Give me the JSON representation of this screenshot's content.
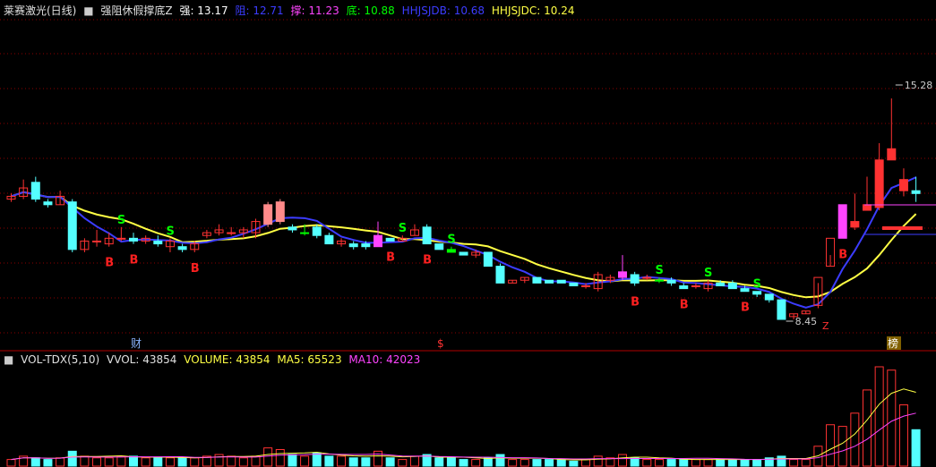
{
  "header": {
    "title": "莱赛激光(日线)",
    "indicator": "强阻休假撑底Z",
    "strong_label": "强: 13.17",
    "resist_label": "阻: 12.71",
    "support_label": "撑: 11.23",
    "bottom_label": "底: 10.88",
    "hhjsjdb_label": "HHJSJDB: 10.68",
    "hhjsjdc_label": "HHJSJDC: 10.24"
  },
  "volume_header": {
    "name": "VOL-TDX(5,10)",
    "vvol": "VVOL: 43854",
    "volume": "VOLUME: 43854",
    "ma5": "MA5: 65523",
    "ma10": "MA10: 42023"
  },
  "annotations": {
    "high": "15.28",
    "low": "8.45",
    "marker_cai": "财",
    "marker_s": "$",
    "marker_bang": "榜",
    "marker_z": "Z"
  },
  "colors": {
    "up": "#ff3232",
    "up_fill_light": "#ff9a9a",
    "down": "#54ffff",
    "down_dark": "#14b4b4",
    "buy_sig": "#ff2020",
    "sell_sig": "#00ff00",
    "magenta": "#ff44ff",
    "ma_blue": "#3c3cff",
    "ma_yellow": "#ffff44",
    "grid": "#8b0000",
    "white": "#ffffff"
  },
  "chart_data": [
    {
      "type": "candlestick",
      "title": "莱赛激光(日线)",
      "ohlc": [
        [
          11.2,
          11.4,
          11.1,
          11.3
        ],
        [
          11.3,
          11.9,
          11.2,
          11.6
        ],
        [
          11.8,
          12.0,
          11.1,
          11.2
        ],
        [
          11.1,
          11.2,
          10.9,
          11.0
        ],
        [
          11.0,
          11.5,
          11.0,
          11.3
        ],
        [
          11.1,
          11.2,
          9.3,
          9.4
        ],
        [
          9.4,
          9.8,
          9.3,
          9.7
        ],
        [
          9.7,
          10.1,
          9.5,
          9.7
        ],
        [
          9.6,
          10.0,
          9.5,
          9.8
        ],
        [
          9.8,
          10.2,
          9.7,
          9.8
        ],
        [
          9.8,
          10.0,
          9.6,
          9.7
        ],
        [
          9.7,
          9.9,
          9.6,
          9.8
        ],
        [
          9.7,
          9.9,
          9.5,
          9.6
        ],
        [
          9.5,
          9.8,
          9.3,
          9.7
        ],
        [
          9.5,
          9.6,
          9.3,
          9.4
        ],
        [
          9.4,
          9.7,
          9.3,
          9.6
        ],
        [
          9.9,
          10.1,
          9.8,
          10.0
        ],
        [
          10.0,
          10.3,
          9.9,
          10.1
        ],
        [
          10.0,
          10.2,
          9.9,
          10.0
        ],
        [
          10.0,
          10.2,
          9.8,
          10.1
        ],
        [
          10.0,
          10.5,
          9.8,
          10.4
        ],
        [
          10.3,
          11.1,
          10.2,
          11.0
        ],
        [
          10.4,
          11.2,
          10.3,
          11.1
        ],
        [
          10.2,
          10.3,
          10.0,
          10.1
        ],
        [
          10.0,
          10.3,
          9.9,
          10.0
        ],
        [
          10.2,
          10.3,
          9.8,
          9.9
        ],
        [
          9.9,
          10.0,
          9.6,
          9.6
        ],
        [
          9.6,
          9.8,
          9.5,
          9.7
        ],
        [
          9.6,
          9.7,
          9.4,
          9.5
        ],
        [
          9.6,
          9.7,
          9.4,
          9.5
        ],
        [
          9.5,
          10.4,
          9.5,
          9.9
        ],
        [
          9.8,
          9.8,
          9.7,
          9.7
        ],
        [
          9.7,
          9.9,
          9.7,
          9.8
        ],
        [
          9.9,
          10.3,
          9.9,
          10.1
        ],
        [
          10.2,
          10.3,
          9.6,
          9.6
        ],
        [
          9.6,
          9.6,
          9.4,
          9.4
        ],
        [
          9.4,
          9.5,
          9.3,
          9.3
        ],
        [
          9.3,
          9.3,
          9.2,
          9.2
        ],
        [
          9.2,
          9.4,
          9.1,
          9.3
        ],
        [
          9.3,
          9.3,
          8.8,
          8.8
        ],
        [
          8.8,
          8.9,
          8.2,
          8.2
        ],
        [
          8.2,
          8.3,
          8.2,
          8.3
        ],
        [
          8.3,
          8.4,
          8.2,
          8.4
        ],
        [
          8.4,
          8.4,
          8.2,
          8.2
        ],
        [
          8.3,
          8.3,
          8.2,
          8.2
        ],
        [
          8.3,
          8.3,
          8.2,
          8.2
        ],
        [
          8.2,
          8.2,
          8.1,
          8.1
        ],
        [
          8.1,
          8.2,
          8.0,
          8.1
        ],
        [
          8.0,
          8.6,
          7.9,
          8.5
        ],
        [
          8.3,
          8.5,
          8.2,
          8.4
        ],
        [
          8.4,
          9.2,
          8.3,
          8.6
        ],
        [
          8.5,
          8.6,
          8.1,
          8.2
        ],
        [
          8.4,
          8.5,
          8.3,
          8.4
        ],
        [
          8.3,
          8.4,
          8.2,
          8.3
        ],
        [
          8.3,
          8.4,
          8.1,
          8.2
        ],
        [
          8.1,
          8.2,
          8.0,
          8.0
        ],
        [
          8.1,
          8.2,
          8.0,
          8.1
        ],
        [
          8.0,
          8.3,
          7.9,
          8.2
        ],
        [
          8.2,
          8.3,
          8.1,
          8.1
        ],
        [
          8.2,
          8.3,
          8.0,
          8.0
        ],
        [
          8.0,
          8.1,
          7.9,
          7.9
        ],
        [
          7.9,
          7.9,
          7.7,
          7.8
        ],
        [
          7.8,
          7.8,
          7.5,
          7.6
        ],
        [
          7.6,
          7.6,
          6.9,
          6.9
        ],
        [
          7.0,
          7.1,
          6.9,
          7.1
        ],
        [
          7.1,
          7.2,
          7.1,
          7.2
        ],
        [
          7.4,
          8.2,
          7.3,
          8.4
        ],
        [
          8.8,
          9.2,
          8.8,
          9.8
        ],
        [
          9.8,
          11.0,
          9.8,
          11.0
        ],
        [
          10.2,
          11.4,
          10.1,
          10.4
        ],
        [
          10.8,
          12.0,
          10.8,
          11.0
        ],
        [
          10.9,
          13.2,
          10.8,
          12.6
        ],
        [
          12.6,
          14.8,
          12.6,
          13.0
        ],
        [
          11.5,
          12.3,
          11.3,
          11.9
        ],
        [
          11.5,
          12.0,
          11.1,
          11.4
        ]
      ]
    },
    {
      "type": "bar",
      "title": "VOL-TDX(5,10)",
      "values": [
        0.4,
        0.6,
        0.5,
        0.4,
        0.5,
        0.9,
        0.6,
        0.5,
        0.5,
        0.6,
        0.6,
        0.5,
        0.5,
        0.5,
        0.5,
        0.5,
        0.6,
        0.7,
        0.6,
        0.5,
        0.6,
        1.1,
        1.0,
        0.7,
        0.6,
        0.8,
        0.6,
        0.6,
        0.5,
        0.5,
        0.9,
        0.5,
        0.4,
        0.6,
        0.7,
        0.5,
        0.5,
        0.4,
        0.4,
        0.5,
        0.7,
        0.4,
        0.4,
        0.4,
        0.4,
        0.4,
        0.3,
        0.4,
        0.6,
        0.5,
        0.7,
        0.5,
        0.4,
        0.4,
        0.4,
        0.4,
        0.4,
        0.4,
        0.4,
        0.4,
        0.4,
        0.4,
        0.5,
        0.6,
        0.4,
        0.4,
        1.2,
        2.5,
        2.4,
        3.2,
        4.6,
        6.0,
        5.8,
        3.7,
        2.2
      ]
    }
  ]
}
